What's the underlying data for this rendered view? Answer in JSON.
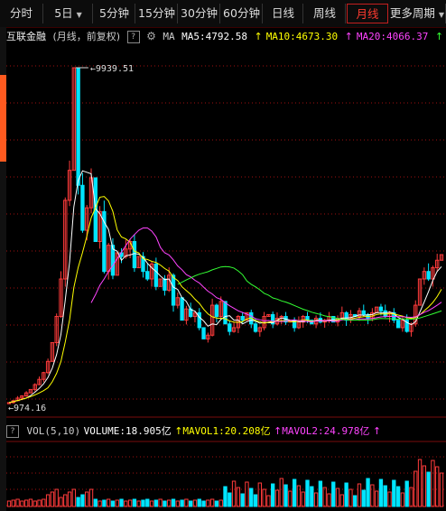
{
  "tabs": [
    {
      "label": "分时",
      "active": false
    },
    {
      "label": "5日",
      "active": false,
      "dropdown": true
    },
    {
      "label": "5分钟",
      "active": false
    },
    {
      "label": "15分钟",
      "active": false
    },
    {
      "label": "30分钟",
      "active": false
    },
    {
      "label": "60分钟",
      "active": false
    },
    {
      "label": "日线",
      "active": false
    },
    {
      "label": "周线",
      "active": false
    },
    {
      "label": "月线",
      "active": true
    },
    {
      "label": "更多周期",
      "active": false,
      "dropdown": true
    }
  ],
  "info": {
    "stock_name": "互联金融",
    "period_note": "(月线，前复权)",
    "ma_label": "MA",
    "ma5": "MA5:4792.58",
    "ma10": "MA10:4673.30",
    "ma20": "MA20:4066.37",
    "ma_more": "MA"
  },
  "price": {
    "high_label": "9939.51",
    "low_label": "974.16"
  },
  "volume": {
    "vol_label": "VOL(5,10)",
    "volume": "VOLUME:18.905亿",
    "mavol1": "MAVOL1:20.208亿",
    "mavol2": "MAVOL2:24.978亿"
  },
  "colors": {
    "up": "#ff3b3b",
    "down": "#00e5ff",
    "ma5": "#ffffff",
    "ma10": "#ffff00",
    "ma20": "#ff44ff",
    "ma_extra": "#33ff33",
    "background": "#000000",
    "grid": "#a01010"
  },
  "chart_data": {
    "type": "candlestick",
    "price_range": [
      974.16,
      9939.51
    ],
    "series_names": [
      "MA5",
      "MA10",
      "MA20"
    ],
    "ma_latest": {
      "MA5": 4792.58,
      "MA10": 4673.3,
      "MA20": 4066.37
    },
    "volume_unit": "亿",
    "volume_latest": 18.905,
    "mavol_latest": {
      "MAVOL1": 20.208,
      "MAVOL2": 24.978
    }
  }
}
